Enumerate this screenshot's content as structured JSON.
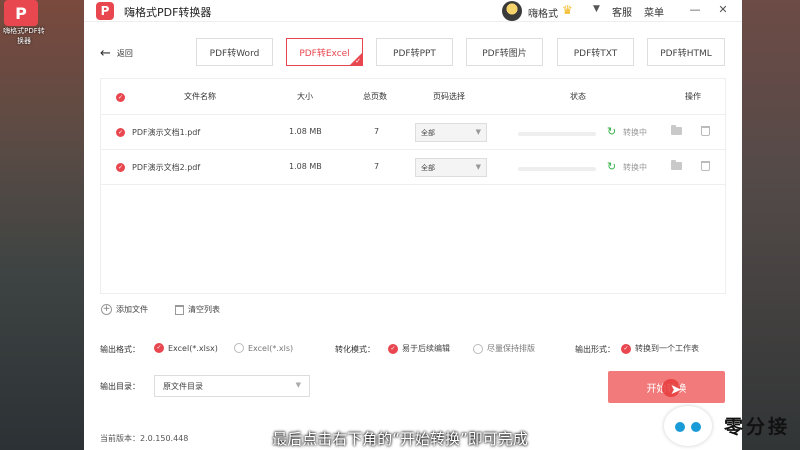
{
  "desktop": {
    "icon_glyph": "P",
    "icon_label": "嗨格式PDF转换器"
  },
  "window": {
    "title": "嗨格式PDF转换器",
    "logo_glyph": "P",
    "user": {
      "name": "嗨格式",
      "crown_icon": "crown-icon",
      "caret": "▼"
    },
    "links": [
      "客服",
      "菜单"
    ],
    "controls": {
      "minimize": "—",
      "close": "✕"
    }
  },
  "nav": {
    "back_arrow": "←",
    "back_label": "返回",
    "tabs": [
      {
        "label": "PDF转Word",
        "active": false
      },
      {
        "label": "PDF转Excel",
        "active": true
      },
      {
        "label": "PDF转PPT",
        "active": false
      },
      {
        "label": "PDF转图片",
        "active": false
      },
      {
        "label": "PDF转TXT",
        "active": false
      },
      {
        "label": "PDF转HTML",
        "active": false
      }
    ]
  },
  "table": {
    "headers": [
      "文件名称",
      "大小",
      "总页数",
      "页码选择",
      "状态",
      "操作"
    ],
    "rows": [
      {
        "name": "PDF演示文档1.pdf",
        "size": "1.08 MB",
        "pages": "7",
        "page_select": "全部",
        "status": "转换中",
        "progress": 0
      },
      {
        "name": "PDF演示文档2.pdf",
        "size": "1.08 MB",
        "pages": "7",
        "page_select": "全部",
        "status": "转换中",
        "progress": 0
      }
    ]
  },
  "actions": {
    "add_files": "添加文件",
    "clear_list": "清空列表"
  },
  "options": {
    "output_format_label": "输出格式：",
    "formats": [
      {
        "label": "Excel(*.xlsx)",
        "selected": true
      },
      {
        "label": "Excel(*.xls)",
        "selected": false
      }
    ],
    "mode_label": "转化模式：",
    "modes": [
      {
        "label": "易于后续编辑",
        "selected": true
      },
      {
        "label": "尽量保持排版",
        "selected": false
      }
    ],
    "form_label": "输出形式：",
    "forms": [
      {
        "label": "转换到一个工作表",
        "selected": true
      }
    ]
  },
  "output_dir": {
    "label": "输出目录：",
    "value": "原文件目录"
  },
  "start_button": "开始转换",
  "version": "当前版本：2.0.150.448",
  "subtitle": "最后点击右下角的“开始转换”即可完成",
  "watermark": {
    "text": "零分接"
  },
  "colors": {
    "accent": "#e8474f",
    "start_button": "#f37a7a",
    "status_icon": "#38b24a"
  }
}
